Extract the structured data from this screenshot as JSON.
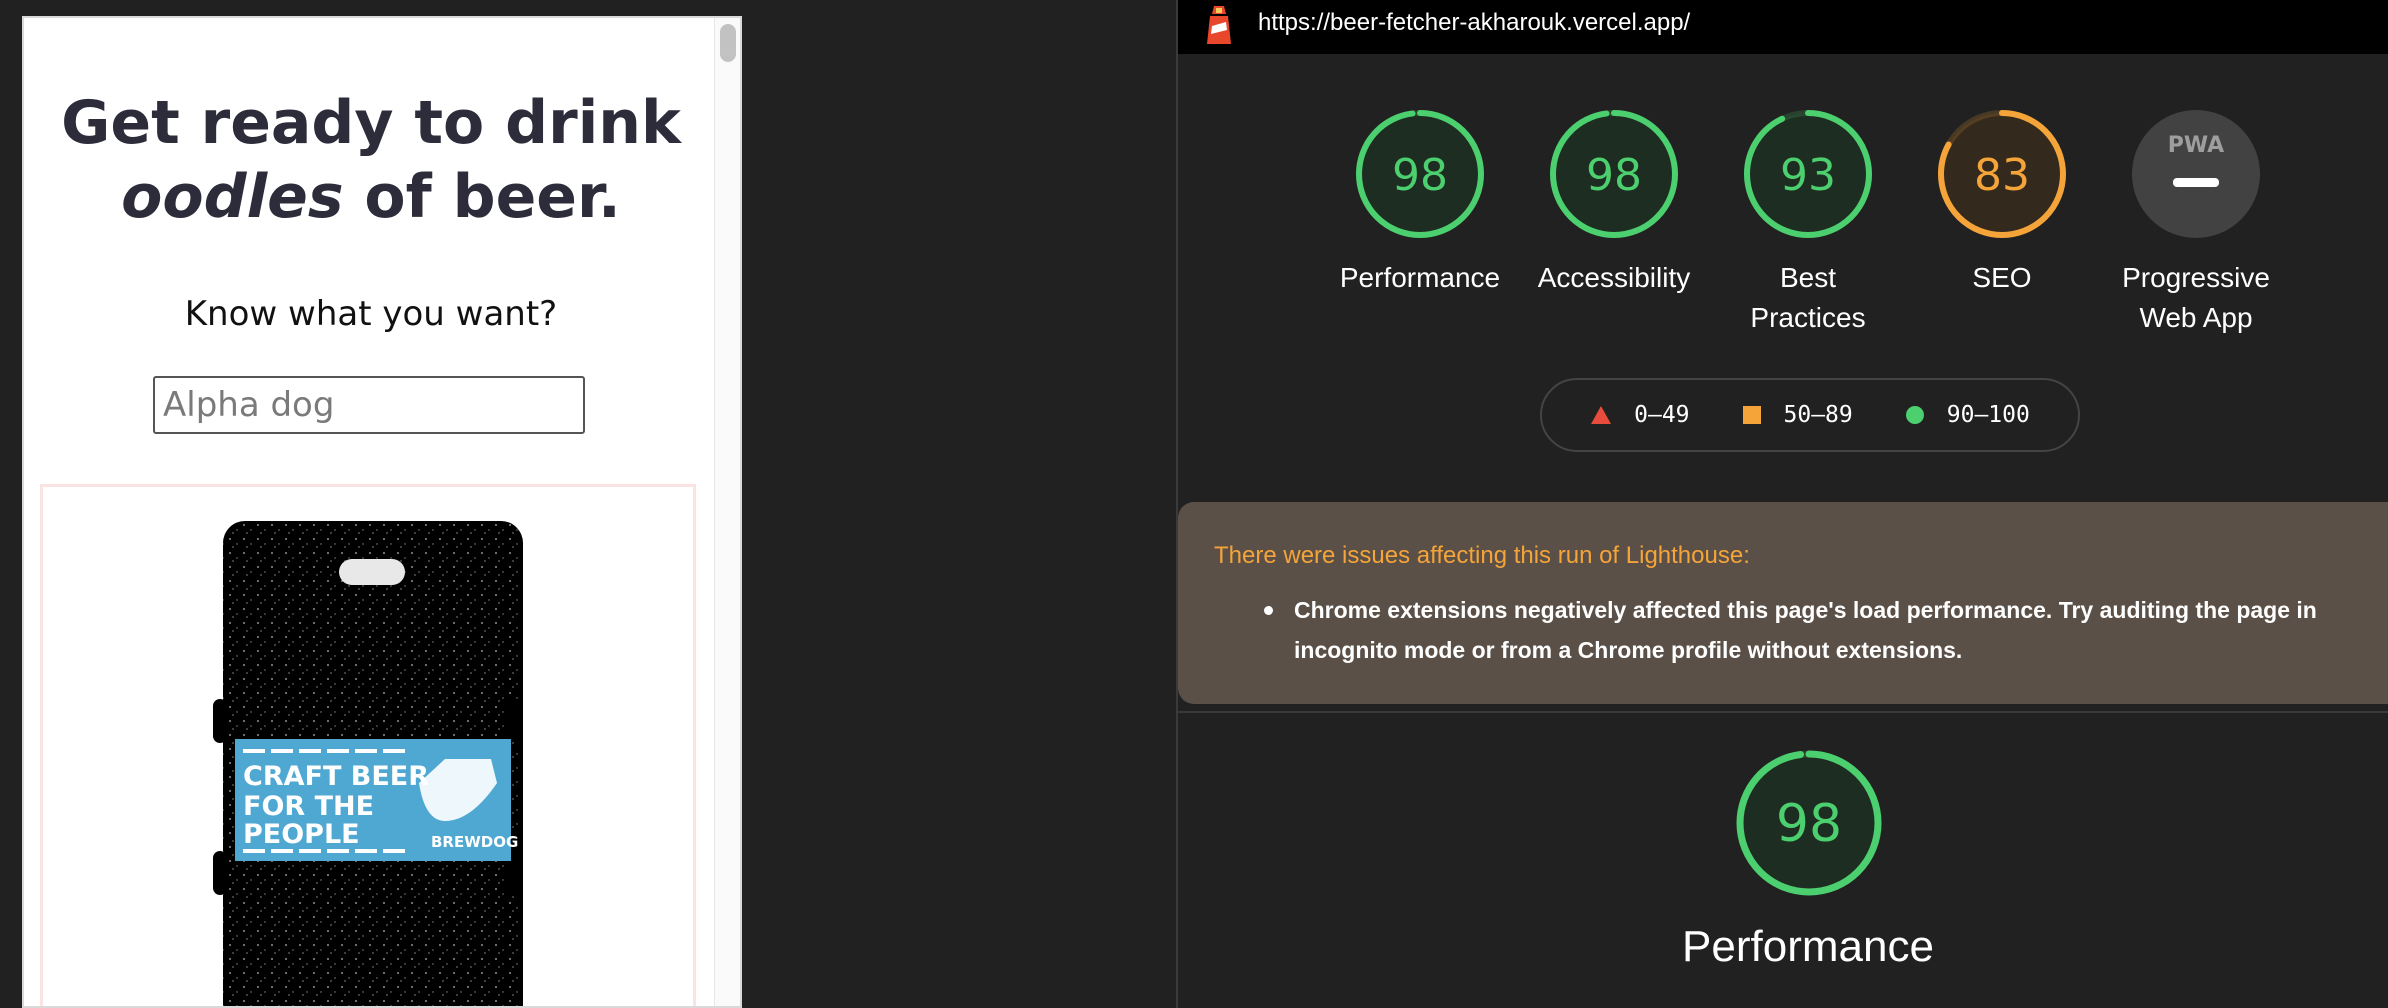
{
  "preview": {
    "title_line1": "Get ready to drink",
    "title_em": "oodles",
    "title_rest": " of beer.",
    "know_label": "Know what you want?",
    "search_placeholder": "Alpha dog",
    "can_label": {
      "line1": "CRAFT BEER",
      "line2": "FOR THE",
      "line3": "PEOPLE",
      "brand": "BREWDOG"
    }
  },
  "lighthouse": {
    "url": "https://beer-fetcher-akharouk.vercel.app/",
    "gauges": [
      {
        "score": "98",
        "label": "Performance",
        "color": "#4ccf6e",
        "fraction": 0.98
      },
      {
        "score": "98",
        "label": "Accessibility",
        "color": "#4ccf6e",
        "fraction": 0.98
      },
      {
        "score": "93",
        "label": "Best Practices",
        "color": "#4ccf6e",
        "fraction": 0.93
      },
      {
        "score": "83",
        "label": "SEO",
        "color": "#f5a43a",
        "fraction": 0.83
      }
    ],
    "pwa": {
      "badge": "PWA",
      "label": "Progressive Web App"
    },
    "legend": [
      {
        "range": "0–49",
        "icon": "triangle-icon",
        "color": "#e74c3c"
      },
      {
        "range": "50–89",
        "icon": "square-icon",
        "color": "#f5a43a"
      },
      {
        "range": "90–100",
        "icon": "circle-icon",
        "color": "#4ccf6e"
      }
    ],
    "warning": {
      "title": "There were issues affecting this run of Lighthouse:",
      "item": "Chrome extensions negatively affected this page's load performance. Try auditing the page in incognito mode or from a Chrome profile without extensions."
    },
    "detail": {
      "score": "98",
      "label": "Performance",
      "fraction": 0.98,
      "color": "#4ccf6e"
    }
  }
}
